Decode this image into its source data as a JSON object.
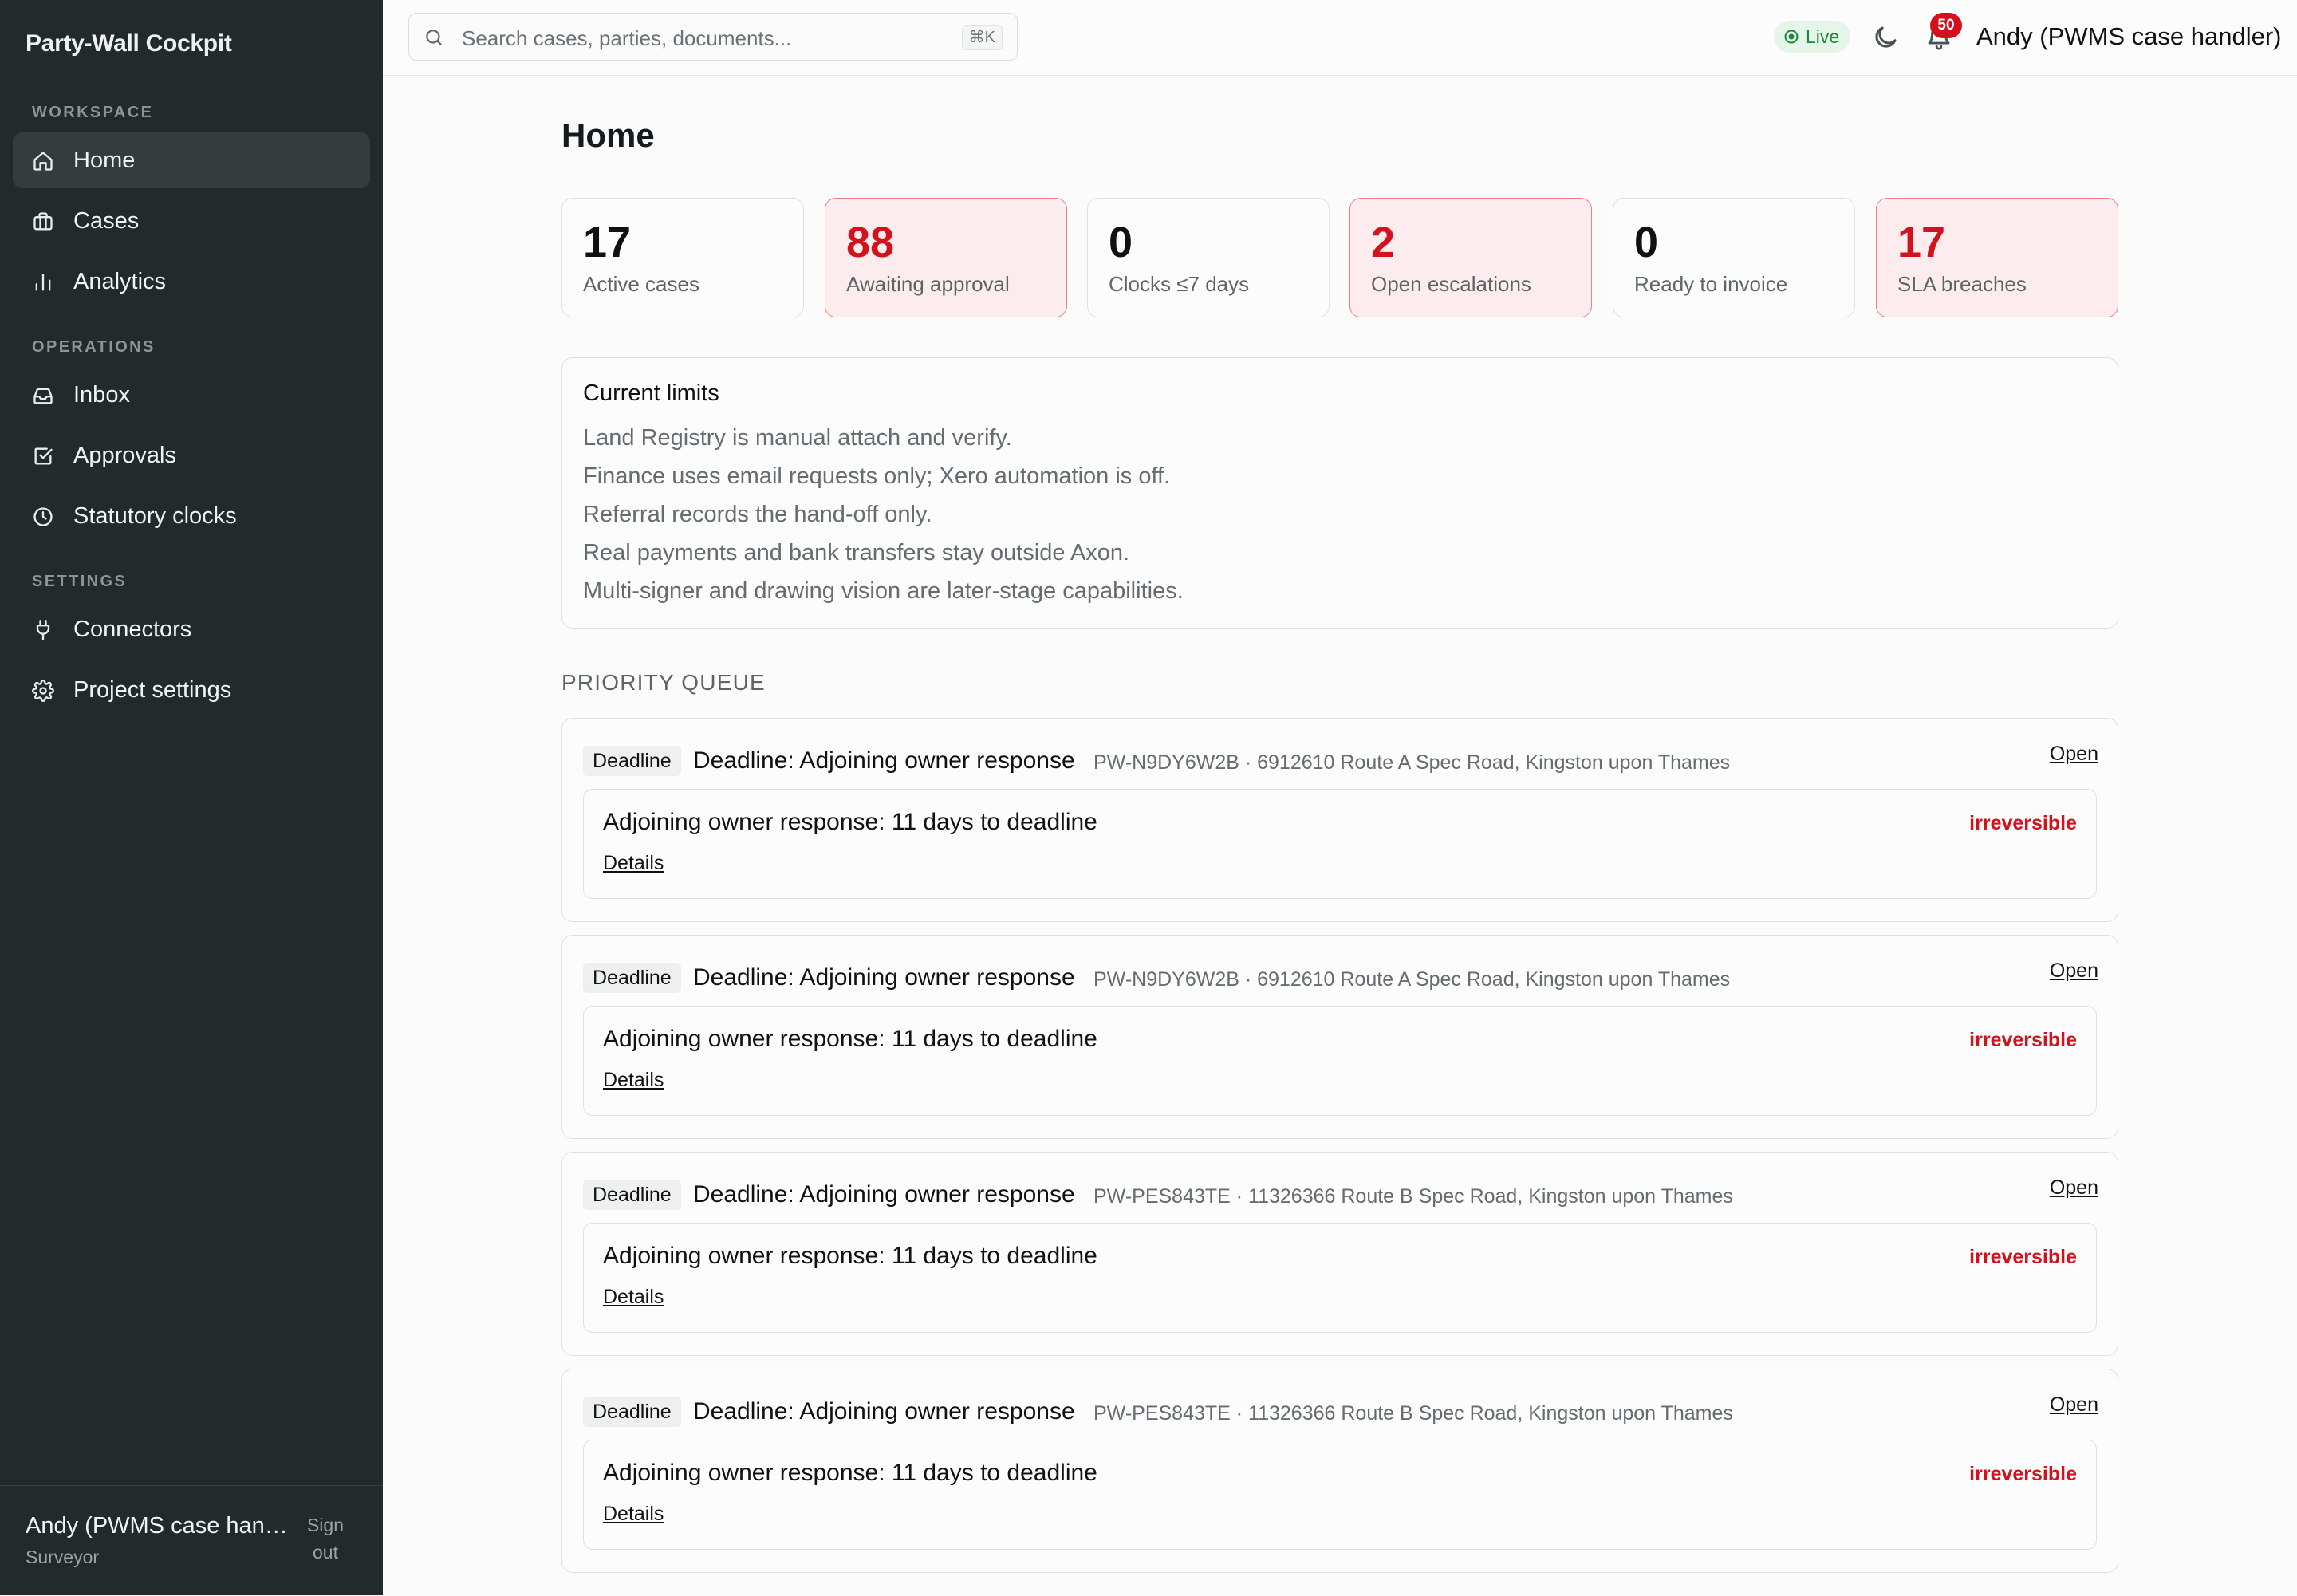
{
  "app": {
    "brand": "Party-Wall Cockpit"
  },
  "sidebar": {
    "sections": [
      {
        "label": "WORKSPACE"
      },
      {
        "label": "OPERATIONS"
      },
      {
        "label": "SETTINGS"
      }
    ],
    "items": [
      {
        "label": "Home",
        "icon": "home-icon",
        "active": true
      },
      {
        "label": "Cases",
        "icon": "briefcase-icon"
      },
      {
        "label": "Analytics",
        "icon": "bar-chart-icon"
      },
      {
        "label": "Inbox",
        "icon": "inbox-icon"
      },
      {
        "label": "Approvals",
        "icon": "check-square-icon"
      },
      {
        "label": "Statutory clocks",
        "icon": "clock-icon"
      },
      {
        "label": "Connectors",
        "icon": "plug-icon"
      },
      {
        "label": "Project settings",
        "icon": "gear-icon"
      }
    ],
    "footer": {
      "name": "Andy (PWMS case handler)",
      "role": "Surveyor",
      "signout": "Sign out"
    }
  },
  "topbar": {
    "search_placeholder": "Search cases, parties, documents...",
    "shortcut": "⌘K",
    "status": "Live",
    "notification_count": "50",
    "user": "Andy (PWMS case handler)"
  },
  "main": {
    "title": "Home",
    "stats": [
      {
        "value": "17",
        "label": "Active cases",
        "alert": false
      },
      {
        "value": "88",
        "label": "Awaiting approval",
        "alert": true
      },
      {
        "value": "0",
        "label": "Clocks ≤7 days",
        "alert": false
      },
      {
        "value": "2",
        "label": "Open escalations",
        "alert": true
      },
      {
        "value": "0",
        "label": "Ready to invoice",
        "alert": false
      },
      {
        "value": "17",
        "label": "SLA breaches",
        "alert": true
      }
    ],
    "limits": {
      "title": "Current limits",
      "lines": [
        "Land Registry is manual attach and verify.",
        "Finance uses email requests only; Xero automation is off.",
        "Referral records the hand-off only.",
        "Real payments and bank transfers stay outside Axon.",
        "Multi-signer and drawing vision are later-stage capabilities."
      ]
    },
    "queue": {
      "heading": "PRIORITY QUEUE",
      "items": [
        {
          "tag": "Deadline",
          "title": "Deadline: Adjoining owner response",
          "meta": "PW-N9DY6W2B · 6912610 Route A Spec Road, Kingston upon Thames",
          "open": "Open",
          "text": "Adjoining owner response: 11 days to deadline",
          "flag": "irreversible",
          "details": "Details"
        },
        {
          "tag": "Deadline",
          "title": "Deadline: Adjoining owner response",
          "meta": "PW-N9DY6W2B · 6912610 Route A Spec Road, Kingston upon Thames",
          "open": "Open",
          "text": "Adjoining owner response: 11 days to deadline",
          "flag": "irreversible",
          "details": "Details"
        },
        {
          "tag": "Deadline",
          "title": "Deadline: Adjoining owner response",
          "meta": "PW-PES843TE · 11326366 Route B Spec Road, Kingston upon Thames",
          "open": "Open",
          "text": "Adjoining owner response: 11 days to deadline",
          "flag": "irreversible",
          "details": "Details"
        },
        {
          "tag": "Deadline",
          "title": "Deadline: Adjoining owner response",
          "meta": "PW-PES843TE · 11326366 Route B Spec Road, Kingston upon Thames",
          "open": "Open",
          "text": "Adjoining owner response: 11 days to deadline",
          "flag": "irreversible",
          "details": "Details"
        }
      ]
    }
  }
}
